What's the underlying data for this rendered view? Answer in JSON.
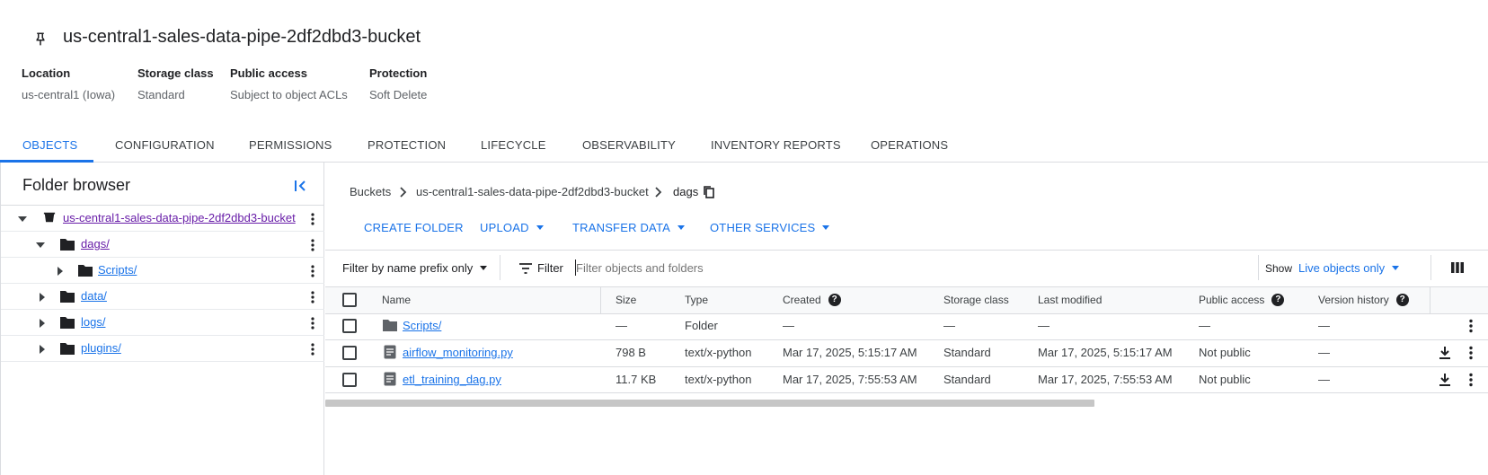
{
  "header": {
    "title": "us-central1-sales-data-pipe-2df2dbd3-bucket",
    "meta": [
      {
        "label": "Location",
        "value": "us-central1 (Iowa)"
      },
      {
        "label": "Storage class",
        "value": "Standard"
      },
      {
        "label": "Public access",
        "value": "Subject to object ACLs"
      },
      {
        "label": "Protection",
        "value": "Soft Delete"
      }
    ]
  },
  "tabs": [
    "OBJECTS",
    "CONFIGURATION",
    "PERMISSIONS",
    "PROTECTION",
    "LIFECYCLE",
    "OBSERVABILITY",
    "INVENTORY REPORTS",
    "OPERATIONS"
  ],
  "folder_browser": {
    "title": "Folder browser",
    "items": [
      {
        "label": "us-central1-sales-data-pipe-2df2dbd3-bucket",
        "icon": "bucket-icon",
        "expanded": true
      },
      {
        "label": "dags/",
        "icon": "folder-icon",
        "expanded": true
      },
      {
        "label": "Scripts/",
        "icon": "folder-icon",
        "expanded": false
      },
      {
        "label": "data/",
        "icon": "folder-icon",
        "expanded": false
      },
      {
        "label": "logs/",
        "icon": "folder-icon",
        "expanded": false
      },
      {
        "label": "plugins/",
        "icon": "folder-icon",
        "expanded": false
      }
    ]
  },
  "breadcrumb": [
    "Buckets",
    "us-central1-sales-data-pipe-2df2dbd3-bucket",
    "dags"
  ],
  "actions": {
    "create_folder": "CREATE FOLDER",
    "upload": "UPLOAD",
    "transfer_data": "TRANSFER DATA",
    "other_services": "OTHER SERVICES"
  },
  "filterbar": {
    "mode": "Filter by name prefix only",
    "filter_label": "Filter",
    "placeholder": "Filter objects and folders",
    "show_label": "Show",
    "show_value": "Live objects only"
  },
  "table": {
    "columns": [
      "Name",
      "Size",
      "Type",
      "Created",
      "Storage class",
      "Last modified",
      "Public access",
      "Version history"
    ],
    "rows": [
      {
        "name": "Scripts/",
        "size": "—",
        "type": "Folder",
        "created": "—",
        "storage_class": "—",
        "last_modified": "—",
        "public_access": "—",
        "version_history": "—"
      },
      {
        "name": "airflow_monitoring.py",
        "size": "798 B",
        "type": "text/x-python",
        "created": "Mar 17, 2025, 5:15:17 AM",
        "storage_class": "Standard",
        "last_modified": "Mar 17, 2025, 5:15:17 AM",
        "public_access": "Not public",
        "version_history": "—"
      },
      {
        "name": "etl_training_dag.py",
        "size": "11.7 KB",
        "type": "text/x-python",
        "created": "Mar 17, 2025, 7:55:53 AM",
        "storage_class": "Standard",
        "last_modified": "Mar 17, 2025, 7:55:53 AM",
        "public_access": "Not public",
        "version_history": "—"
      }
    ]
  },
  "colors": {
    "accent": "#1a73e8",
    "visited_link": "#681da8",
    "border": "#dadce0"
  }
}
